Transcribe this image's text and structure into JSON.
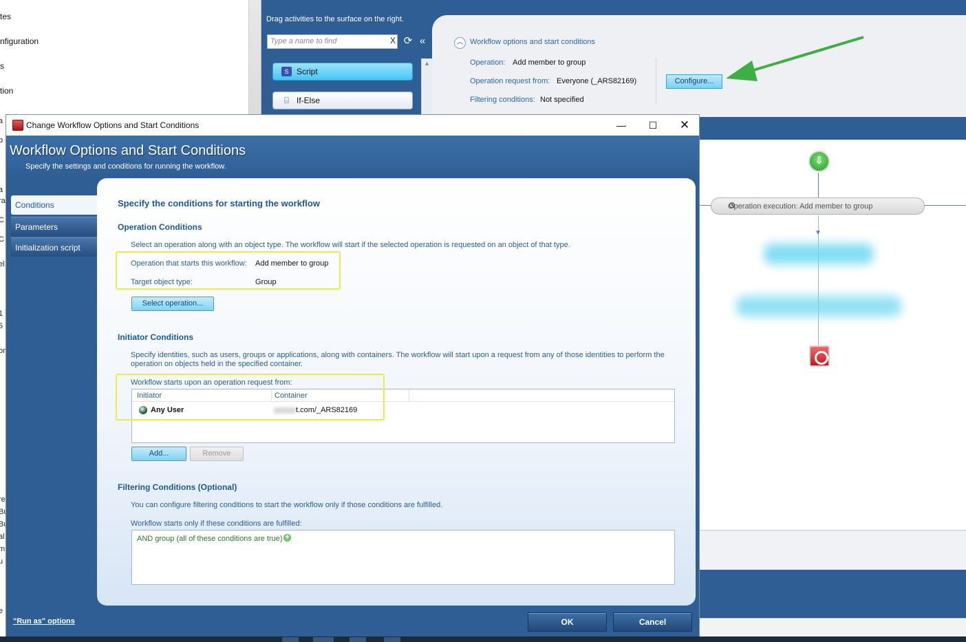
{
  "left_tree": {
    "items": [
      "tes",
      "nfiguration",
      "s",
      "tion"
    ],
    "strip_fragments": [
      "a",
      "p",
      "a",
      "ra",
      "C",
      "C",
      "el",
      "1",
      "5",
      "on",
      "re",
      "Bu",
      "Bu",
      "al",
      "m",
      "u",
      "e"
    ]
  },
  "toolbox": {
    "hint": "Drag activities to the surface on the right.",
    "search_placeholder": "Type a name to find",
    "search_clear": "X",
    "activities": [
      {
        "label": "Script",
        "icon": "script-icon"
      },
      {
        "label": "If-Else",
        "icon": "if-else-icon"
      }
    ]
  },
  "designer": {
    "options_title": "Workflow options and start conditions",
    "operation_label": "Operation:",
    "operation_value": "Add member to group",
    "request_from_label": "Operation request from:",
    "request_from_value": "Everyone (_ARS82169)",
    "filtering_label": "Filtering conditions:",
    "filtering_value": "Not specified",
    "configure_label": "Configure...",
    "op_exec_label": "Operation execution: Add member to group",
    "annotation_color": "#3cb043"
  },
  "dialog": {
    "title": "Change Workflow Options and Start Conditions",
    "window_controls": {
      "minimize": "—",
      "maximize": "☐",
      "close": "✕"
    },
    "heading": "Workflow Options and Start Conditions",
    "subheading": "Specify the settings and conditions for running the workflow.",
    "nav": [
      "Conditions",
      "Parameters",
      "Initialization script"
    ],
    "section_title": "Specify the conditions for starting the workflow",
    "operation_conditions": {
      "heading": "Operation Conditions",
      "description": "Select an operation along with an object type. The workflow will start if the selected operation is requested on an object of that type.",
      "operation_label": "Operation that starts this workflow:",
      "operation_value": "Add member to group",
      "target_label": "Target object type:",
      "target_value": "Group",
      "select_button": "Select operation..."
    },
    "initiator_conditions": {
      "heading": "Initiator Conditions",
      "description_line1": "Specify identities, such as users, groups or applications, along with containers. The workflow will start upon a request from any of those identities to perform the",
      "description_line2": "operation on objects held in the specified container.",
      "list_label": "Workflow starts upon an operation request from:",
      "columns": [
        "Initiator",
        "Container"
      ],
      "rows": [
        {
          "initiator": "Any User",
          "container": "t.com/_ARS82169"
        }
      ],
      "add_button": "Add...",
      "remove_button": "Remove"
    },
    "filtering_conditions": {
      "heading": "Filtering Conditions (Optional)",
      "description": "You can configure filtering conditions to start the workflow only if those conditions are fulfilled.",
      "list_label": "Workflow starts only if these conditions are fulfilled:",
      "group_text": "AND group (all of these conditions are true)"
    },
    "run_as_link": "\"Run as\" options",
    "ok_button": "OK",
    "cancel_button": "Cancel",
    "highlight_color": "#ecec47"
  }
}
